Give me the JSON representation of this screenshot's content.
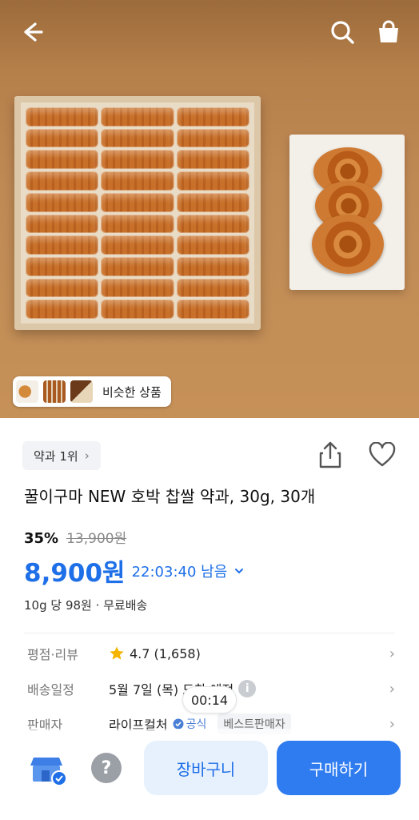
{
  "header": {
    "back_icon": "arrow-left-icon",
    "search_icon": "search-icon",
    "cart_icon": "shopping-bag-icon"
  },
  "similar": {
    "label": "비슷한 상품"
  },
  "badge": {
    "label": "약과 1위",
    "chevron": "›"
  },
  "product": {
    "title": "꿀이구마 NEW 호박 찹쌀 약과, 30g, 30개",
    "discount": "35%",
    "original_price": "13,900원",
    "price": "8,900원",
    "timer": "22:03:40 남음",
    "unit_info": "10g 당 98원 · 무료배송"
  },
  "details": {
    "rating_label": "평점·리뷰",
    "rating_value": "4.7 (1,658)",
    "delivery_label": "배송일정",
    "delivery_value": "5월 7일 (목) 도착 예정",
    "seller_label": "판매자",
    "seller_value": "라이프컬처",
    "official": "공식",
    "best_seller": "베스트판매자"
  },
  "overlay_timer": "00:14",
  "bottom_bar": {
    "help": "?",
    "cart": "장바구니",
    "buy": "구매하기"
  },
  "colors": {
    "accent": "#2f7cf0",
    "price": "#1e6fe8",
    "star": "#f5b400"
  }
}
